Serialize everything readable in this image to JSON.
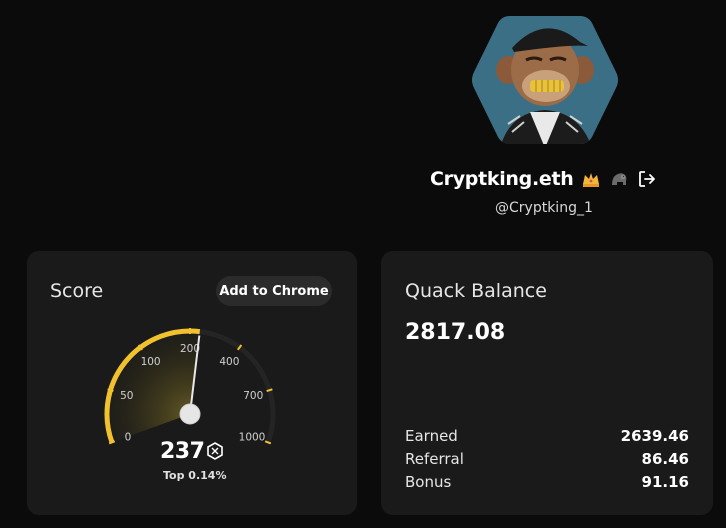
{
  "profile": {
    "username": "Cryptking.eth",
    "handle": "@Cryptking_1",
    "badges": [
      "crown-icon",
      "gorilla-icon"
    ],
    "logout_icon": "logout-icon"
  },
  "score": {
    "title": "Score",
    "add_to_chrome": "Add to Chrome",
    "value": "237",
    "rank": "Top 0.14%",
    "ticks": [
      "0",
      "50",
      "100",
      "200",
      "400",
      "700",
      "1000"
    ],
    "accent": "#f2c12e"
  },
  "balance": {
    "title": "Quack Balance",
    "value": "2817.08",
    "rows": [
      {
        "label": "Earned",
        "value": "2639.46"
      },
      {
        "label": "Referral",
        "value": "86.46"
      },
      {
        "label": "Bonus",
        "value": "91.16"
      }
    ]
  }
}
